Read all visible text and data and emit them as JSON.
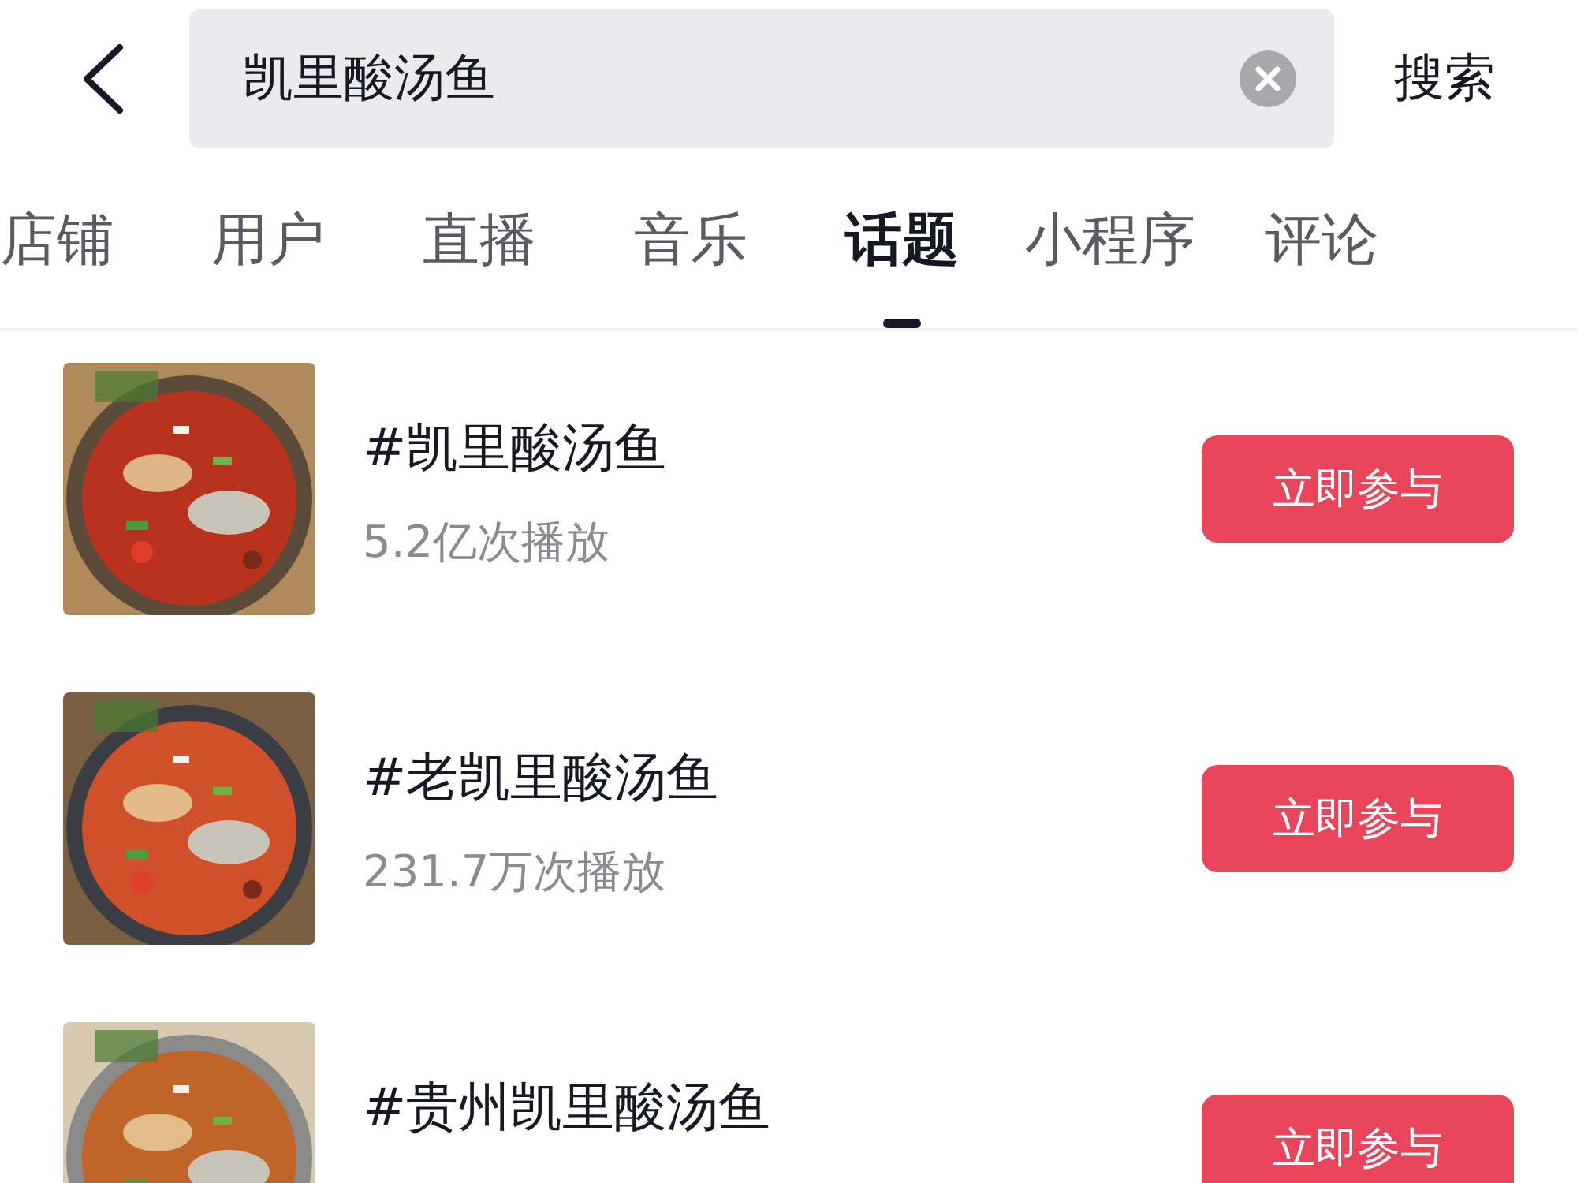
{
  "header": {
    "search": {
      "value": "凯里酸汤鱼"
    },
    "search_button": "搜索"
  },
  "tabs": [
    {
      "label": "店铺",
      "selected": false
    },
    {
      "label": "用户",
      "selected": false
    },
    {
      "label": "直播",
      "selected": false
    },
    {
      "label": "音乐",
      "selected": false
    },
    {
      "label": "话题",
      "selected": true
    },
    {
      "label": "小程序",
      "selected": false
    },
    {
      "label": "评论",
      "selected": false
    }
  ],
  "topics": [
    {
      "kind": "picture",
      "title": "#凯里酸汤鱼",
      "plays": "5.2亿次播放",
      "button": "立即参与"
    },
    {
      "kind": "picture",
      "title": "#老凯里酸汤鱼",
      "plays": "231.7万次播放",
      "button": "立即参与"
    },
    {
      "kind": "picture",
      "title": "#贵州凯里酸汤鱼",
      "button": "立即参与"
    }
  ]
}
